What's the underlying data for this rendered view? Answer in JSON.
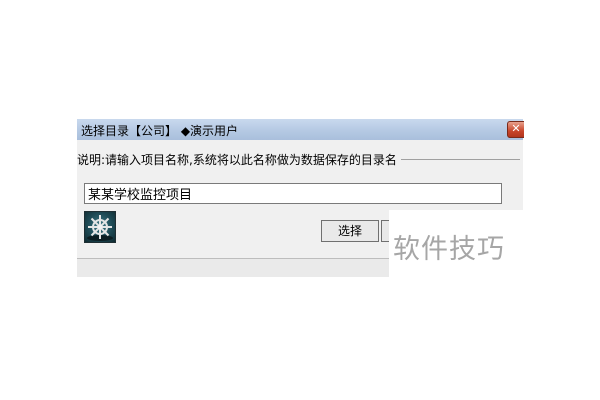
{
  "dialog": {
    "title": "选择目录【公司】 ◆演示用户",
    "close_label": "✕",
    "description": "说明:请输入项目名称,系统将以此名称做为数据保存的目录名",
    "project_name_value": "某某学校监控项目",
    "select_button_label": "选择",
    "app_icon": "ship-wheel-icon"
  },
  "watermark": {
    "text": "软件技巧"
  }
}
